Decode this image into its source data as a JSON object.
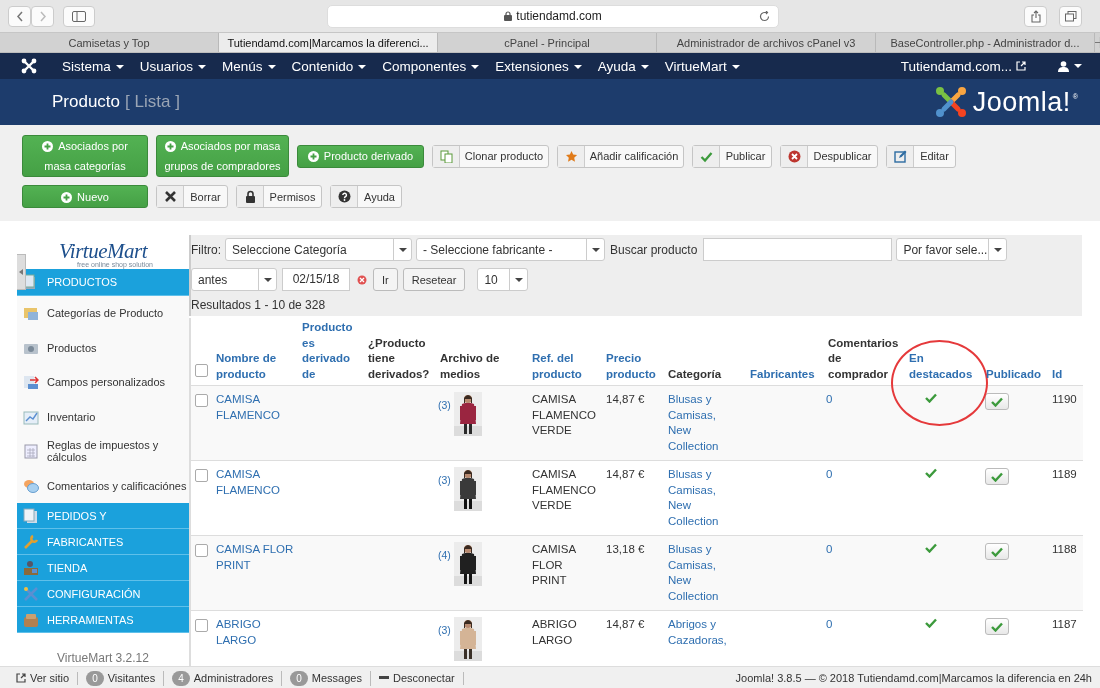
{
  "browser": {
    "address": "tutiendamd.com",
    "tabs": [
      {
        "label": "Camisetas y Top",
        "selected": false
      },
      {
        "label": "Tutiendamd.com|Marcamos la diferenci...",
        "selected": true
      },
      {
        "label": "cPanel - Principal",
        "selected": false
      },
      {
        "label": "Administrador de archivos cPanel v3",
        "selected": false
      },
      {
        "label": "BaseController.php - Administrador d...",
        "selected": false
      }
    ]
  },
  "nav": {
    "menus": [
      "Sistema",
      "Usuarios",
      "Menús",
      "Contenido",
      "Componentes",
      "Extensiones",
      "Ayuda",
      "VirtueMart"
    ],
    "site": "Tutiendamd.com..."
  },
  "header": {
    "title": "Producto",
    "subtitle": "[ Lista ]",
    "brand": "Joomla!",
    "brand_mark": "®"
  },
  "toolbar": {
    "buttons": [
      {
        "label": "Asociados por masa categorías",
        "kind": "primary"
      },
      {
        "label": "Asociados por masa grupos de compradores",
        "kind": "primary"
      },
      {
        "label": "Producto derivado",
        "kind": "primary"
      },
      {
        "label": "Clonar producto",
        "kind": "default"
      },
      {
        "label": "Añadir calificación",
        "kind": "default"
      },
      {
        "label": "Publicar",
        "kind": "default"
      },
      {
        "label": "Despublicar",
        "kind": "default"
      },
      {
        "label": "Editar",
        "kind": "default"
      },
      {
        "label": "Nuevo",
        "kind": "primary"
      },
      {
        "label": "Borrar",
        "kind": "default"
      },
      {
        "label": "Permisos",
        "kind": "default"
      },
      {
        "label": "Ayuda",
        "kind": "default"
      }
    ]
  },
  "sidebar": {
    "logo": "VirtueMart",
    "tagline": "free online shop solution",
    "sections": [
      {
        "label": "PRODUCTOS",
        "expanded": true,
        "children": [
          {
            "label": "Categorías de Producto"
          },
          {
            "label": "Productos"
          },
          {
            "label": "Campos personalizados"
          },
          {
            "label": "Inventario"
          },
          {
            "label": "Reglas de impuestos y cálculos"
          },
          {
            "label": "Comentarios y calificaciónes"
          }
        ]
      },
      {
        "label": "PEDIDOS Y",
        "expanded": false
      },
      {
        "label": "FABRICANTES",
        "expanded": false
      },
      {
        "label": "TIENDA",
        "expanded": false
      },
      {
        "label": "CONFIGURACIÓN",
        "expanded": false
      },
      {
        "label": "HERRAMIENTAS",
        "expanded": false
      }
    ],
    "version": "VirtueMart 3.2.12"
  },
  "filters": {
    "label": "Filtro:",
    "category": "Seleccione Categoría",
    "manufacturer": "- Seleccione fabricante -",
    "search_label": "Buscar producto",
    "status": "Por favor sele...",
    "date_mode": "antes",
    "date": "02/15/18",
    "go": "Ir",
    "reset": "Resetear",
    "limit": "10",
    "results": "Resultados 1 - 10 de 328"
  },
  "table": {
    "all_checked": false,
    "columns": [
      {
        "label": "Nombre de producto",
        "sortable": true,
        "highlighted": false
      },
      {
        "label": "Producto es derivado de",
        "sortable": true,
        "highlighted": false
      },
      {
        "label": "¿Producto tiene derivados?",
        "sortable": false,
        "highlighted": false
      },
      {
        "label": "Archivo de medios",
        "sortable": false,
        "highlighted": false
      },
      {
        "label": "Ref. del producto",
        "sortable": true,
        "highlighted": false
      },
      {
        "label": "Precio producto",
        "sortable": true,
        "highlighted": false
      },
      {
        "label": "Categoría",
        "sortable": false,
        "highlighted": false
      },
      {
        "label": "Fabricantes",
        "sortable": true,
        "highlighted": false
      },
      {
        "label": "Comentarios de comprador",
        "sortable": false,
        "highlighted": false
      },
      {
        "label": "En destacados",
        "sortable": true,
        "highlighted": true
      },
      {
        "label": "Publicado",
        "sortable": true,
        "highlighted": false
      },
      {
        "label": "Id",
        "sortable": true,
        "highlighted": false
      }
    ],
    "rows": [
      {
        "checked": false,
        "name": "CAMISA FLAMENCO",
        "media_count": "(3)",
        "ref": "CAMISA FLAMENCO VERDE",
        "price": "14,87 €",
        "category": "Blusas y Camisas, New Collection",
        "comments": "0",
        "featured": true,
        "published": true,
        "id": "1190"
      },
      {
        "checked": false,
        "name": "CAMISA FLAMENCO",
        "media_count": "(3)",
        "ref": "CAMISA FLAMENCO VERDE",
        "price": "14,87 €",
        "category": "Blusas y Camisas, New Collection",
        "comments": "0",
        "featured": true,
        "published": true,
        "id": "1189"
      },
      {
        "checked": false,
        "name": "CAMISA FLOR PRINT",
        "media_count": "(4)",
        "ref": "CAMISA FLOR PRINT",
        "price": "13,18 €",
        "category": "Blusas y Camisas, New Collection",
        "comments": "0",
        "featured": true,
        "published": true,
        "id": "1188"
      },
      {
        "checked": false,
        "name": "ABRIGO LARGO",
        "media_count": "(3)",
        "ref": "ABRIGO LARGO",
        "price": "14,87 €",
        "category": "Abrigos y Cazadoras,",
        "comments": "0",
        "featured": true,
        "published": true,
        "id": "1187"
      }
    ]
  },
  "footer": {
    "items": [
      {
        "kind": "link",
        "label": "Ver sitio"
      },
      {
        "kind": "count",
        "count": "0",
        "label": "Visitantes"
      },
      {
        "kind": "count",
        "count": "4",
        "label": "Administradores"
      },
      {
        "kind": "count",
        "count": "0",
        "label": "Messages"
      },
      {
        "kind": "logout",
        "label": "Desconectar"
      }
    ],
    "copyright": "Joomla! 3.8.5 — © 2018 Tutiendamd.com|Marcamos la diferencia en 24h"
  }
}
